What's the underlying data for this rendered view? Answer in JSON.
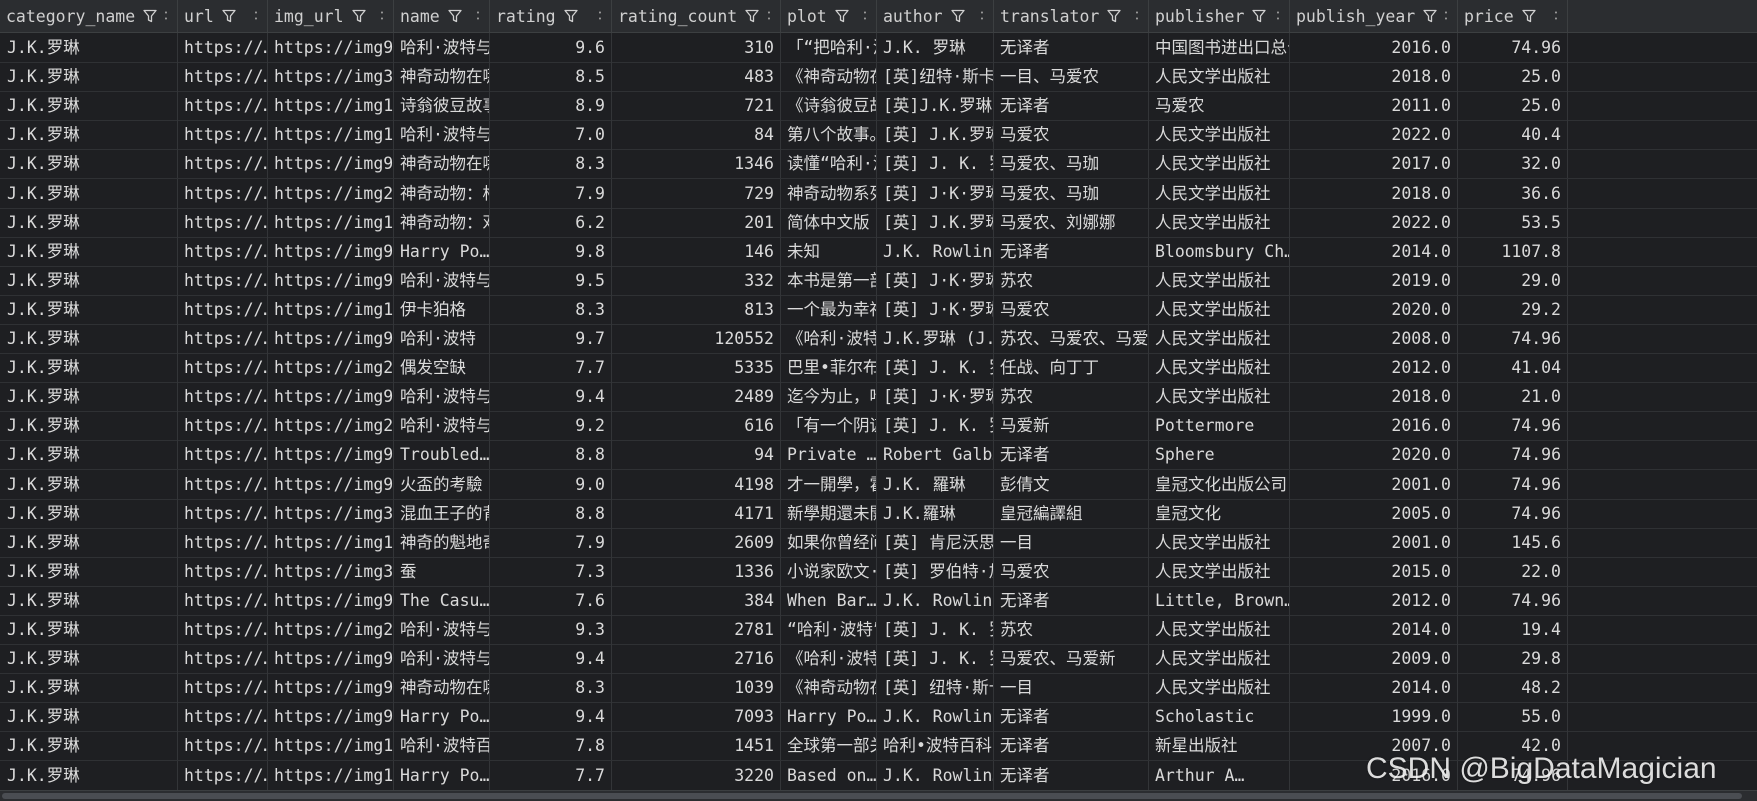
{
  "colors": {
    "bg": "#1e1f22",
    "header_bg": "#2b2d30",
    "text": "#dadada",
    "border": "#3c3f41"
  },
  "columns": [
    {
      "key": "category_name",
      "label": "category_name",
      "align": "left"
    },
    {
      "key": "url",
      "label": "url",
      "align": "left"
    },
    {
      "key": "img_url",
      "label": "img_url",
      "align": "left"
    },
    {
      "key": "name",
      "label": "name",
      "align": "left"
    },
    {
      "key": "rating",
      "label": "rating",
      "align": "right"
    },
    {
      "key": "rating_count",
      "label": "rating_count",
      "align": "right"
    },
    {
      "key": "plot",
      "label": "plot",
      "align": "left"
    },
    {
      "key": "author",
      "label": "author",
      "align": "left"
    },
    {
      "key": "translator",
      "label": "translator",
      "align": "left"
    },
    {
      "key": "publisher",
      "label": "publisher",
      "align": "left"
    },
    {
      "key": "publish_year",
      "label": "publish_year",
      "align": "right"
    },
    {
      "key": "price",
      "label": "price",
      "align": "right"
    }
  ],
  "icons": {
    "filter": "filter-icon",
    "sort": "sort-icon"
  },
  "rows": [
    [
      "J.K.罗琳",
      "https://…",
      "https://img9…",
      "哈利·波特与",
      "9.6",
      "310",
      "「“把哈利·波",
      "J.K. 罗琳",
      "无译者",
      "中国图书进出口总公",
      "2016.0",
      "74.96"
    ],
    [
      "J.K.罗琳",
      "https://…",
      "https://img3…",
      "神奇动物在哪",
      "8.5",
      "483",
      "《神奇动物在",
      "[英]纽特·斯卡",
      "一目、马爱农",
      "人民文学出版社",
      "2018.0",
      "25.0"
    ],
    [
      "J.K.罗琳",
      "https://…",
      "https://img1…",
      "诗翁彼豆故事",
      "8.9",
      "721",
      "《诗翁彼豆故",
      "[英]J.K.罗琳",
      "无译者",
      "马爱农",
      "2011.0",
      "25.0"
    ],
    [
      "J.K.罗琳",
      "https://…",
      "https://img1…",
      "哈利·波特与",
      "7.0",
      "84",
      "第八个故事。",
      "[英] J.K.罗琳",
      "马爱农",
      "人民文学出版社",
      "2022.0",
      "40.4"
    ],
    [
      "J.K.罗琳",
      "https://…",
      "https://img9…",
      "神奇动物在哪",
      "8.3",
      "1346",
      "读懂“哈利·波",
      "[英] J. K. 罗",
      "马爱农、马珈",
      "人民文学出版社",
      "2017.0",
      "32.0"
    ],
    [
      "J.K.罗琳",
      "https://…",
      "https://img2…",
      "神奇动物：格",
      "7.9",
      "729",
      "神奇动物系列",
      "[英] J·K·罗琳",
      "马爱农、马珈",
      "人民文学出版社",
      "2018.0",
      "36.6"
    ],
    [
      "J.K.罗琳",
      "https://…",
      "https://img1…",
      "神奇动物：邓",
      "6.2",
      "201",
      "简体中文版 ·",
      "[英] J.K.罗琳",
      "马爱农、刘娜娜",
      "人民文学出版社",
      "2022.0",
      "53.5"
    ],
    [
      "J.K.罗琳",
      "https://…",
      "https://img9…",
      "Harry Po…",
      "9.8",
      "146",
      "未知",
      "J.K. Rowling",
      "无译者",
      "Bloomsbury Ch…",
      "2014.0",
      "1107.8"
    ],
    [
      "J.K.罗琳",
      "https://…",
      "https://img9…",
      "哈利·波特与",
      "9.5",
      "332",
      "本书是第一部",
      "[英] J·K·罗琳",
      "苏农",
      "人民文学出版社",
      "2019.0",
      "29.0"
    ],
    [
      "J.K.罗琳",
      "https://…",
      "https://img1…",
      "伊卡狛格",
      "8.3",
      "813",
      "一个最为幸福",
      "[英] J·K·罗琳",
      "马爱农",
      "人民文学出版社",
      "2020.0",
      "29.2"
    ],
    [
      "J.K.罗琳",
      "https://…",
      "https://img9…",
      "哈利·波特",
      "9.7",
      "120552",
      "《哈利·波特",
      "J.K.罗琳 (J.K",
      "苏农、马爱农、马爱新",
      "人民文学出版社",
      "2008.0",
      "74.96"
    ],
    [
      "J.K.罗琳",
      "https://…",
      "https://img2…",
      "偶发空缺",
      "7.7",
      "5335",
      "巴里•菲尔布",
      "[英] J. K. 罗",
      "任战、向丁丁",
      "人民文学出版社",
      "2012.0",
      "41.04"
    ],
    [
      "J.K.罗琳",
      "https://…",
      "https://img9…",
      "哈利·波特与",
      "9.4",
      "2489",
      "迄今为止，哈",
      "[英] J·K·罗琳",
      "苏农",
      "人民文学出版社",
      "2018.0",
      "21.0"
    ],
    [
      "J.K.罗琳",
      "https://…",
      "https://img2…",
      "哈利·波特与",
      "9.2",
      "616",
      "「有一个阴谋",
      "[英] J. K. 罗",
      "马爱新",
      "Pottermore",
      "2016.0",
      "74.96"
    ],
    [
      "J.K.罗琳",
      "https://…",
      "https://img9…",
      "Troubled…",
      "8.8",
      "94",
      "Private …",
      "Robert Galb…",
      "无译者",
      "Sphere",
      "2020.0",
      "74.96"
    ],
    [
      "J.K.罗琳",
      "https://…",
      "https://img9…",
      "火盃的考驗",
      "9.0",
      "4198",
      "才一開學，霍",
      "J.K. 羅琳",
      "彭倩文",
      "皇冠文化出版公司",
      "2001.0",
      "74.96"
    ],
    [
      "J.K.罗琳",
      "https://…",
      "https://img3…",
      "混血王子的背",
      "8.8",
      "4171",
      "新學期還未開",
      "J.K.羅琳",
      "皇冠編譯組",
      "皇冠文化",
      "2005.0",
      "74.96"
    ],
    [
      "J.K.罗琳",
      "https://…",
      "https://img1…",
      "神奇的魁地奇",
      "7.9",
      "2609",
      "如果你曾经问",
      "[英] 肯尼沃思",
      "一目",
      "人民文学出版社",
      "2001.0",
      "145.6"
    ],
    [
      "J.K.罗琳",
      "https://…",
      "https://img3…",
      "蚕",
      "7.3",
      "1336",
      "小说家欧文·",
      "[英] 罗伯特·加",
      "马爱农",
      "人民文学出版社",
      "2015.0",
      "22.0"
    ],
    [
      "J.K.罗琳",
      "https://…",
      "https://img9…",
      "The Casu…",
      "7.6",
      "384",
      "When Bar…",
      "J.K. Rowling",
      "无译者",
      "Little, Brown…",
      "2012.0",
      "74.96"
    ],
    [
      "J.K.罗琳",
      "https://…",
      "https://img2…",
      "哈利·波特与",
      "9.3",
      "2781",
      "“哈利·波特”",
      "[英] J. K. 罗",
      "苏农",
      "人民文学出版社",
      "2014.0",
      "19.4"
    ],
    [
      "J.K.罗琳",
      "https://…",
      "https://img9…",
      "哈利·波特与",
      "9.4",
      "2716",
      "《哈利·波特",
      "[英] J. K. 罗",
      "马爱农、马爱新",
      "人民文学出版社",
      "2009.0",
      "29.8"
    ],
    [
      "J.K.罗琳",
      "https://…",
      "https://img9…",
      "神奇动物在哪",
      "8.3",
      "1039",
      "《神奇动物在",
      "[英] 纽特·斯卡",
      "一目",
      "人民文学出版社",
      "2014.0",
      "48.2"
    ],
    [
      "J.K.罗琳",
      "https://…",
      "https://img9…",
      "Harry Po…",
      "9.4",
      "7093",
      "Harry Po…",
      "J.K. Rowling",
      "无译者",
      "Scholastic",
      "1999.0",
      "55.0"
    ],
    [
      "J.K.罗琳",
      "https://…",
      "https://img1…",
      "哈利·波特百",
      "7.8",
      "1451",
      "全球第一部关",
      "哈利•波特百科",
      "无译者",
      "新星出版社",
      "2007.0",
      "42.0"
    ],
    [
      "J.K.罗琳",
      "https://…",
      "https://img1…",
      "Harry Po…",
      "7.7",
      "3220",
      "Based on…",
      "J.K. Rowlin…",
      "无译者",
      "Arthur A…",
      "2016.0",
      "74.96"
    ]
  ],
  "watermark": "CSDN @BigDataMagician"
}
